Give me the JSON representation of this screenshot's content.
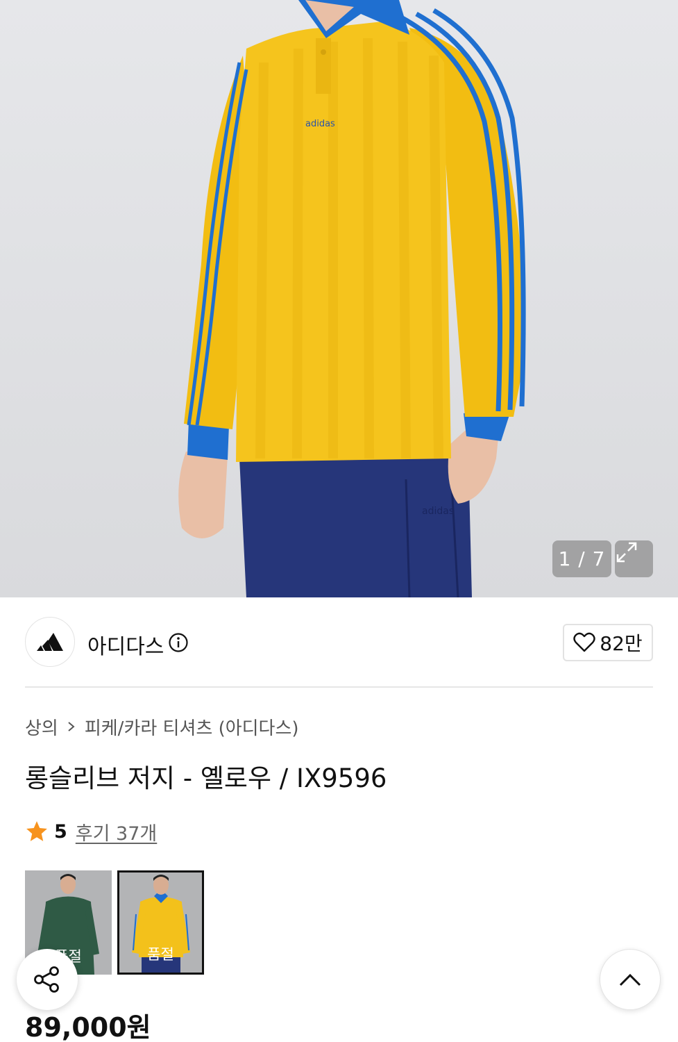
{
  "gallery": {
    "counter": "1 / 7",
    "expand_icon": "expand-icon"
  },
  "brand": {
    "name": "아디다스",
    "logo_icon": "adidas-logo",
    "info_icon": "info-icon",
    "likes": "82만",
    "like_icon": "heart-icon"
  },
  "breadcrumb": {
    "category": "상의",
    "subcategory": "피케/카라 티셔츠 (아디다스)"
  },
  "product": {
    "title": "롱슬리브 저지 - 옐로우 / IX9596",
    "rating": "5",
    "review_link": "후기 37개",
    "price": "89,000원"
  },
  "swatches": [
    {
      "color_name": "green",
      "badge": "품절",
      "selected": false
    },
    {
      "color_name": "yellow",
      "badge": "품절",
      "selected": true
    }
  ],
  "colors": {
    "shirt_yellow": "#f4c21a",
    "stripe_blue": "#1f6fd0",
    "pants_navy": "#26367a",
    "star": "#f7931e"
  },
  "floating": {
    "share_icon": "share-icon",
    "top_icon": "chevron-up-icon"
  }
}
